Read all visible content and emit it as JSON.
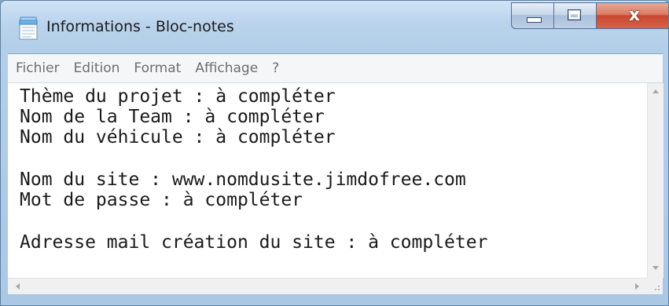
{
  "window": {
    "title": "Informations - Bloc-notes",
    "app_icon": "notepad-icon"
  },
  "caption_buttons": {
    "minimize_icon": "minimize-icon",
    "maximize_icon": "maximize-icon",
    "close_label": "x",
    "close_color": "#c8472e"
  },
  "menu": {
    "items": [
      {
        "label": "Fichier"
      },
      {
        "label": "Edition"
      },
      {
        "label": "Format"
      },
      {
        "label": "Affichage"
      },
      {
        "label": "?"
      }
    ]
  },
  "document": {
    "lines": [
      "Thème du projet : à compléter",
      "Nom de la Team : à compléter",
      "Nom du véhicule : à compléter",
      "",
      "Nom du site : www.nomdusite.jimdofree.com",
      "Mot de passe : à compléter",
      "",
      "Adresse mail création du site : à compléter"
    ]
  },
  "scrollbars": {
    "up_icon": "scroll-up-icon",
    "down_icon": "scroll-down-icon",
    "left_icon": "scroll-left-icon",
    "right_icon": "scroll-right-icon"
  }
}
